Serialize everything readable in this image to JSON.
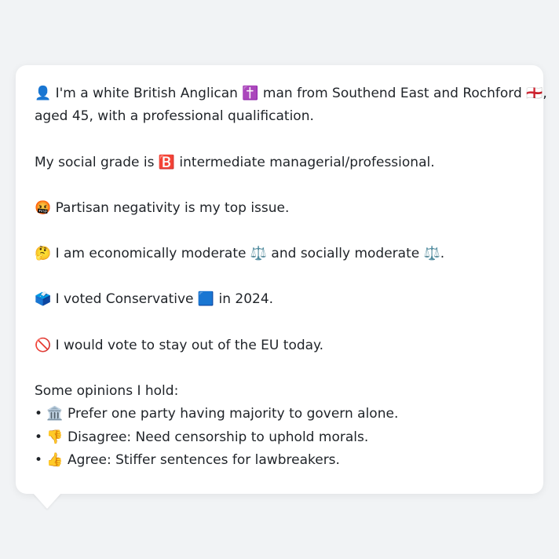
{
  "profile": {
    "line1": "👤 I'm a white British Anglican ✝️ man from Southend East and Rochford 🏴󠁧󠁢󠁥󠁮󠁧󠁿,",
    "line2": "aged 45, with a professional qualification.",
    "social_grade": "My social grade is 🅱️ intermediate managerial/professional.",
    "top_issue": "🤬 Partisan negativity is my top issue.",
    "economic_social": "🤔 I am economically moderate ⚖️ and socially moderate ⚖️.",
    "vote_2024": "🗳️ I voted Conservative 🟦 in 2024.",
    "eu_vote": "🚫 I would vote to stay out of the EU today.",
    "opinions_heading": "Some opinions I hold:",
    "opinions": [
      "• 🏛️ Prefer one party having majority to govern alone.",
      "• 👎 Disagree: Need censorship to uphold morals.",
      "• 👍 Agree: Stiffer sentences for lawbreakers."
    ]
  }
}
